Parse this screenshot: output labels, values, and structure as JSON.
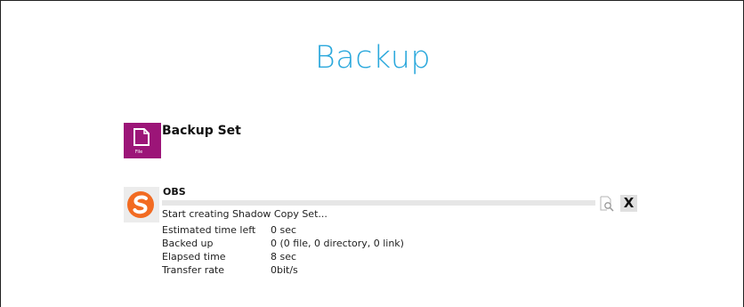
{
  "page": {
    "title": "Backup"
  },
  "backup_set": {
    "heading": "Backup Set",
    "icon": "file-icon",
    "icon_caption": "File",
    "icon_color": "#9c1578"
  },
  "job": {
    "name": "OBS",
    "logo": "obs-logo-icon",
    "logo_color": "#f26b22",
    "status": "Start creating Shadow Copy Set...",
    "progress_percent": 0,
    "stats": [
      {
        "label": "Estimated time left",
        "value": "0 sec"
      },
      {
        "label": "Backed up",
        "value": "0 (0 file, 0 directory, 0 link)"
      },
      {
        "label": "Elapsed time",
        "value": "8 sec"
      },
      {
        "label": "Transfer rate",
        "value": "0bit/s"
      }
    ],
    "actions": {
      "details_icon": "magnify-icon",
      "cancel_label": "X"
    }
  },
  "accent_color": "#2aa8dc"
}
